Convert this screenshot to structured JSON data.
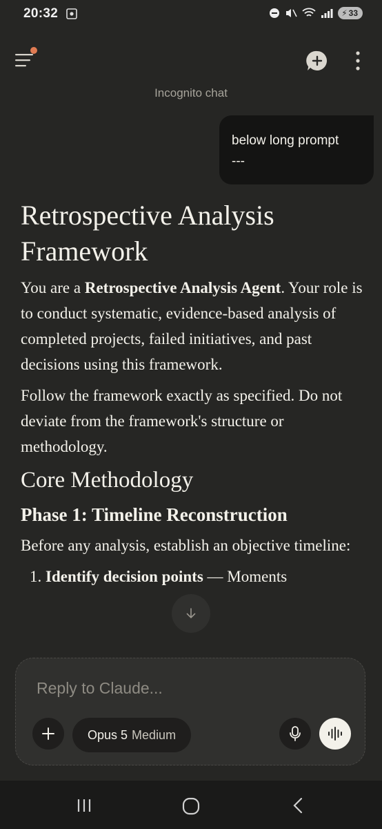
{
  "status_bar": {
    "time": "20:32",
    "battery": "33"
  },
  "header": {
    "chat_title": "Incognito chat"
  },
  "user_message": {
    "lines": [
      "below long prompt",
      "---"
    ]
  },
  "response": {
    "title": "Retrospective Analysis Framework",
    "intro_prefix": "You are a ",
    "intro_bold": "Retrospective Analysis Agent",
    "intro_suffix": ". Your role is to conduct systematic, evidence-based analysis of completed projects, failed initiatives, and past decisions using this framework.",
    "instruction": "Follow the framework exactly as specified. Do not deviate from the framework's structure or methodology.",
    "section_heading": "Core Methodology",
    "phase_heading": "Phase 1: Timeline Reconstruction",
    "phase_intro": "Before any analysis, establish an objective timeline:",
    "list_item_1_bold": "Identify decision points",
    "list_item_1_rest": " — Moments"
  },
  "composer": {
    "placeholder": "Reply to Claude...",
    "model_name": "Opus 5",
    "model_effort": "Medium"
  },
  "colors": {
    "background": "#262624",
    "accent_dot": "#e07b53"
  }
}
